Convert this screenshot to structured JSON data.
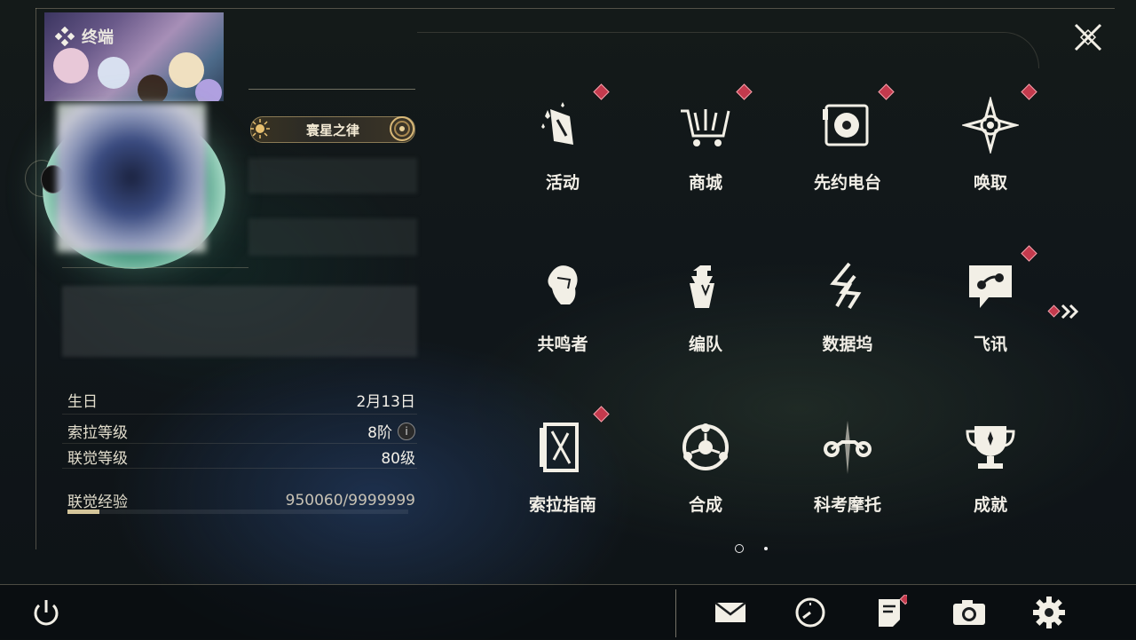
{
  "header": {
    "title": "终端"
  },
  "profile": {
    "badge_label": "寰星之律"
  },
  "info": {
    "birthday_label": "生日",
    "birthday_value": "2月13日",
    "sola_level_label": "索拉等级",
    "sola_level_value": "8阶",
    "union_level_label": "联觉等级",
    "union_level_value": "80级",
    "union_exp_label": "联觉经验",
    "union_exp_value": "950060/9999999",
    "union_exp_progress": 0.095
  },
  "menu": {
    "items": [
      {
        "label": "活动",
        "icon": "events-icon",
        "badge": true
      },
      {
        "label": "商城",
        "icon": "shop-icon",
        "badge": true
      },
      {
        "label": "先约电台",
        "icon": "radio-icon",
        "badge": true
      },
      {
        "label": "唤取",
        "icon": "convene-icon",
        "badge": true
      },
      {
        "label": "共鸣者",
        "icon": "resonator-icon",
        "badge": false
      },
      {
        "label": "编队",
        "icon": "team-icon",
        "badge": false
      },
      {
        "label": "数据坞",
        "icon": "databank-icon",
        "badge": false
      },
      {
        "label": "飞讯",
        "icon": "messages-icon",
        "badge": true
      },
      {
        "label": "索拉指南",
        "icon": "guidebook-icon",
        "badge": true
      },
      {
        "label": "合成",
        "icon": "synthesis-icon",
        "badge": false
      },
      {
        "label": "科考摩托",
        "icon": "motorcycle-icon",
        "badge": false
      },
      {
        "label": "成就",
        "icon": "achievement-icon",
        "badge": false
      }
    ],
    "page_current": 1,
    "page_total": 2
  },
  "bottom": {
    "icons": [
      "power-icon",
      "mail-icon",
      "clock-icon",
      "notice-icon",
      "camera-icon",
      "settings-icon"
    ]
  },
  "colors": {
    "accent": "#c43a4d",
    "gold": "#d4c59a"
  }
}
